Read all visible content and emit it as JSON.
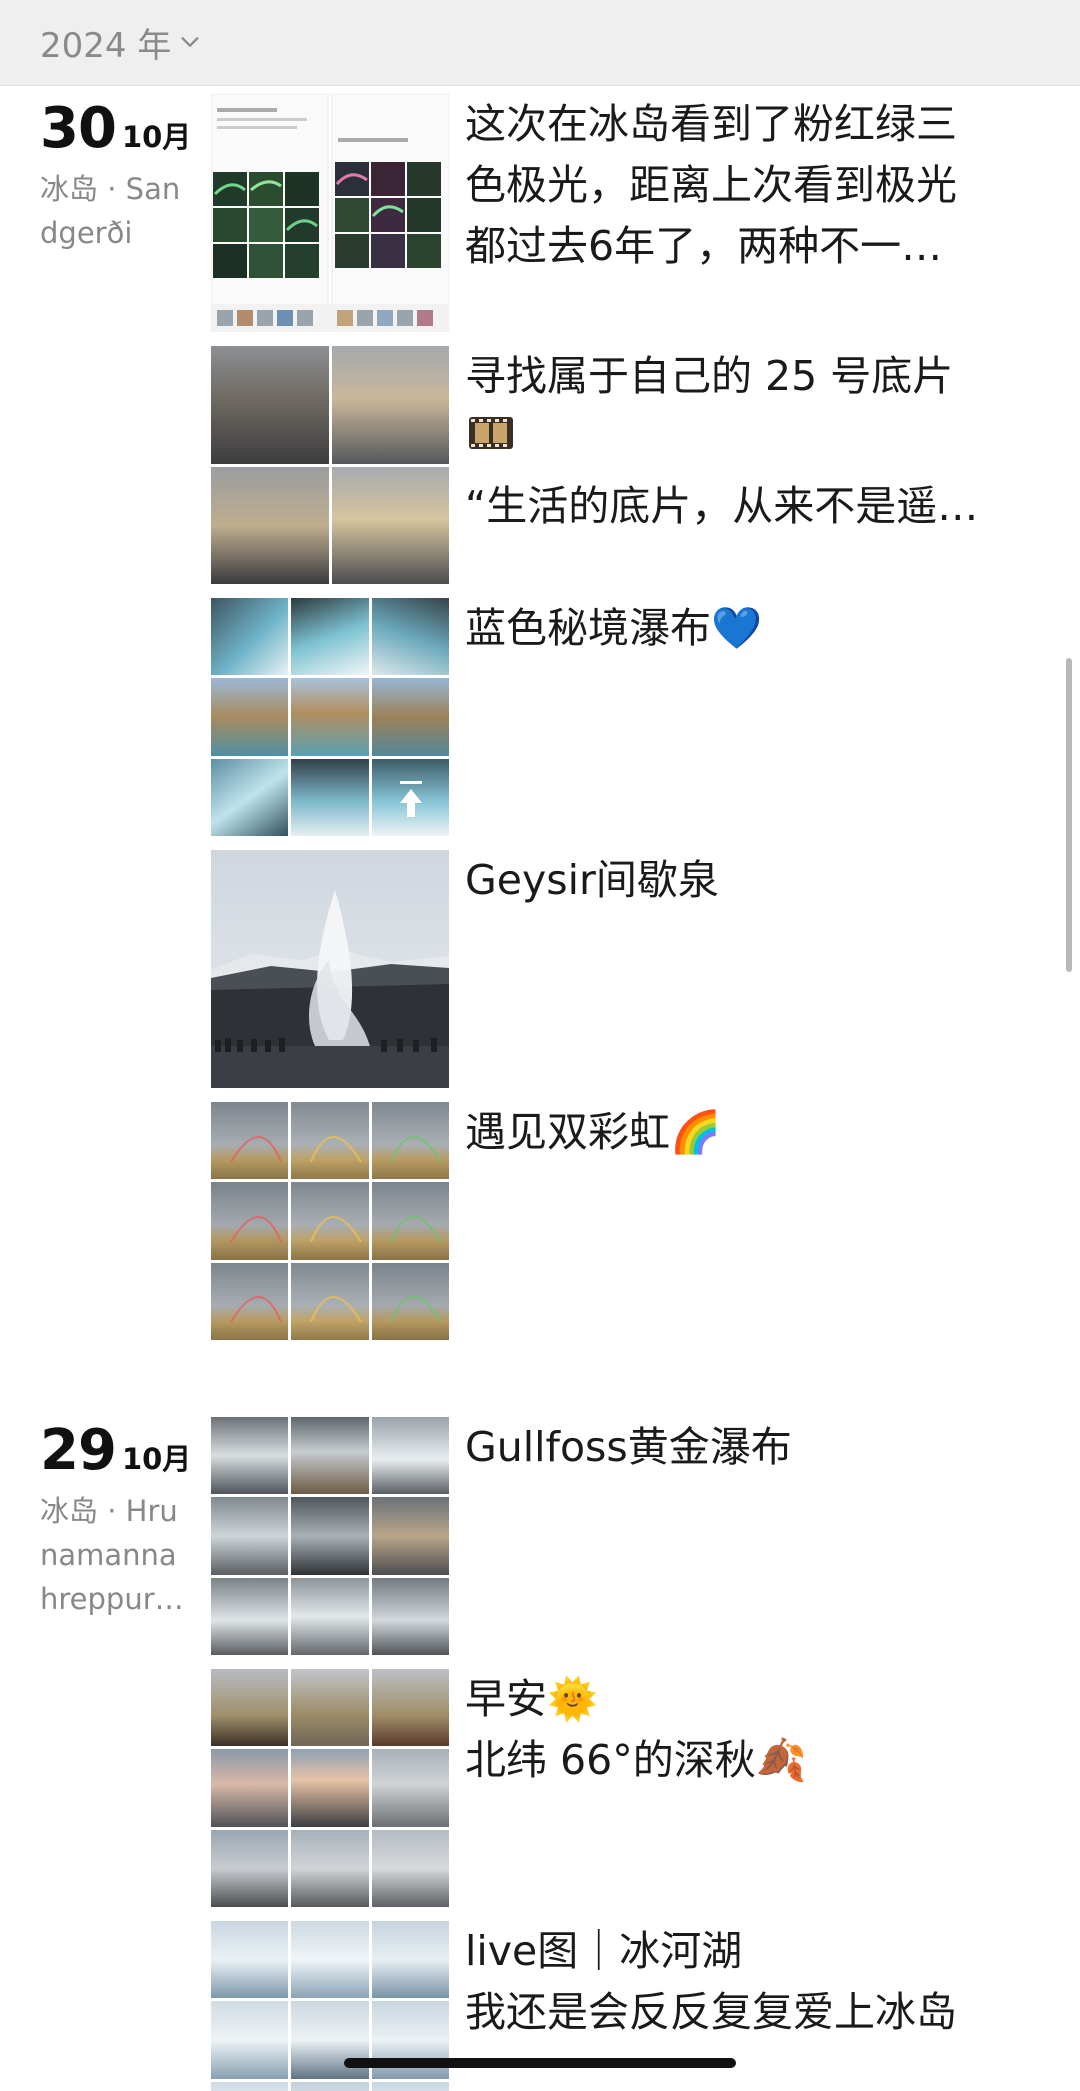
{
  "header": {
    "year": "2024 年"
  },
  "days": [
    {
      "day": "30",
      "month": "10月",
      "location": "冰岛 · Sandgerði",
      "posts": [
        {
          "lines": [
            "这次在冰岛看到了粉红绿三",
            "色极光，距离上次看到极光",
            "都过去6年了，两种不一…"
          ]
        },
        {
          "lines": [
            "寻找属于自己的 25 号底片",
            "🎞️",
            "“生活的底片，从来不是遥…"
          ]
        },
        {
          "lines": [
            "蓝色秘境瀑布💙"
          ]
        },
        {
          "lines": [
            "Geysir间歇泉"
          ]
        },
        {
          "lines": [
            "遇见双彩虹🌈"
          ]
        }
      ]
    },
    {
      "day": "29",
      "month": "10月",
      "location": "冰岛 · Hrunamannahreppur…",
      "posts": [
        {
          "lines": [
            "Gullfoss黄金瀑布"
          ]
        },
        {
          "lines": [
            "早安🌞",
            "北纬 66°的深秋🍂"
          ]
        },
        {
          "lines": [
            "live图｜冰河湖",
            "我还是会反反复复爱上冰岛"
          ]
        }
      ]
    }
  ],
  "icons": {
    "year_dropdown": "chevron-down-icon",
    "film": "film-frames-icon",
    "blue_heart": "blue-heart-icon",
    "rainbow": "rainbow-icon",
    "sun": "sun-icon",
    "leaf": "fallen-leaf-icon"
  },
  "colors": {
    "header_bg": "#efefef",
    "secondary_text": "#888888",
    "primary_text": "#1a1a1a"
  }
}
